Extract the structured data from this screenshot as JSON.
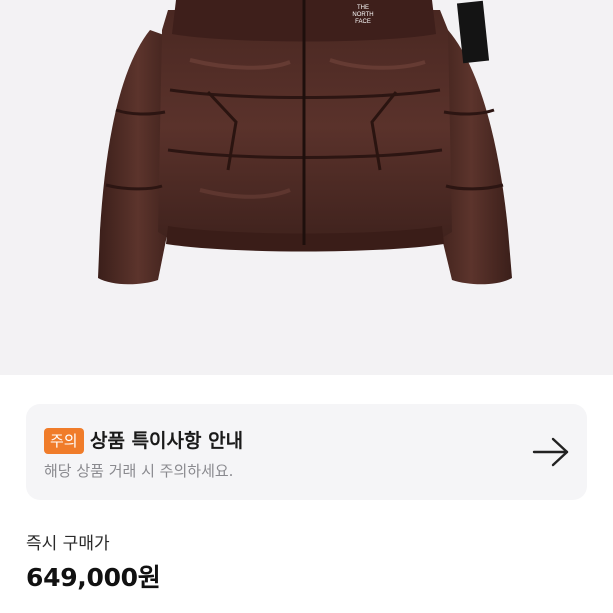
{
  "product": {
    "image_icon": "down-jacket-image",
    "logo_text": [
      "THE",
      "NORTH",
      "FACE"
    ]
  },
  "notice": {
    "tag": "주의",
    "title": "상품 특이사항 안내",
    "subtitle": "해당 상품 거래 시 주의하세요.",
    "arrow_icon": "arrow-right-icon",
    "tag_color": "#f07c2a"
  },
  "price": {
    "label": "즉시 구매가",
    "value": "649,000원"
  }
}
